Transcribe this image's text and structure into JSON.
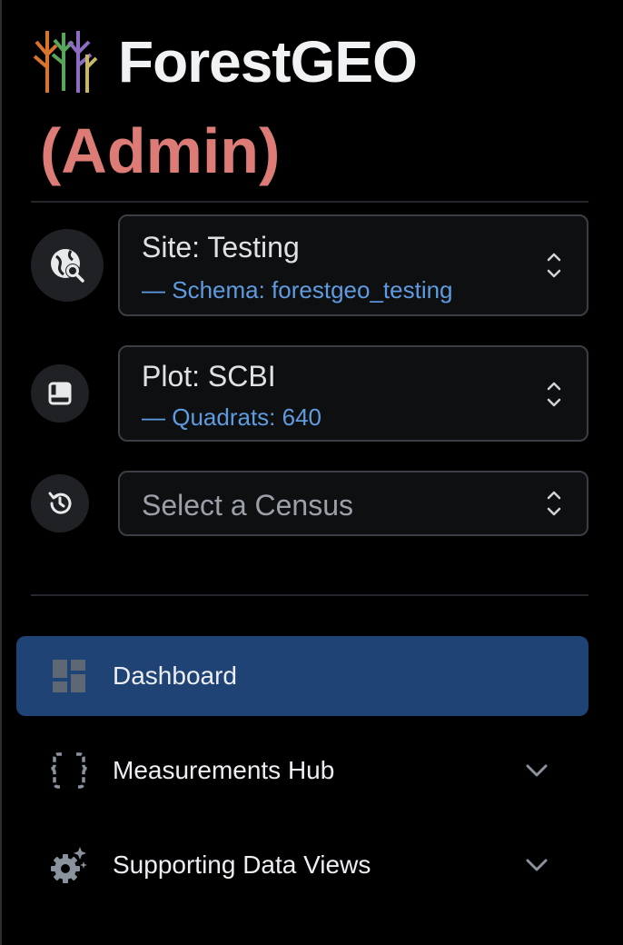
{
  "header": {
    "app_title": "ForestGEO",
    "role": "(Admin)",
    "logo_icon": "tree-logo-icon"
  },
  "selectors": {
    "site": {
      "title": "Site: Testing",
      "subtitle": "— Schema: forestgeo_testing",
      "icon": "globe-search-icon"
    },
    "plot": {
      "title": "Plot: SCBI",
      "subtitle": "— Quadrats: 640",
      "icon": "plot-grid-icon"
    },
    "census": {
      "placeholder": "Select a Census",
      "icon": "history-icon"
    }
  },
  "nav": {
    "items": [
      {
        "label": "Dashboard",
        "icon": "dashboard-icon",
        "active": true
      },
      {
        "label": "Measurements Hub",
        "icon": "curly-braces-icon",
        "expandable": true
      },
      {
        "label": "Supporting Data Views",
        "icon": "gear-sparkle-icon",
        "expandable": true
      }
    ]
  },
  "colors": {
    "background": "#000000",
    "accent_active": "#1f4375",
    "role_text": "#dd7c76",
    "subtitle_text": "#5f9be0"
  }
}
